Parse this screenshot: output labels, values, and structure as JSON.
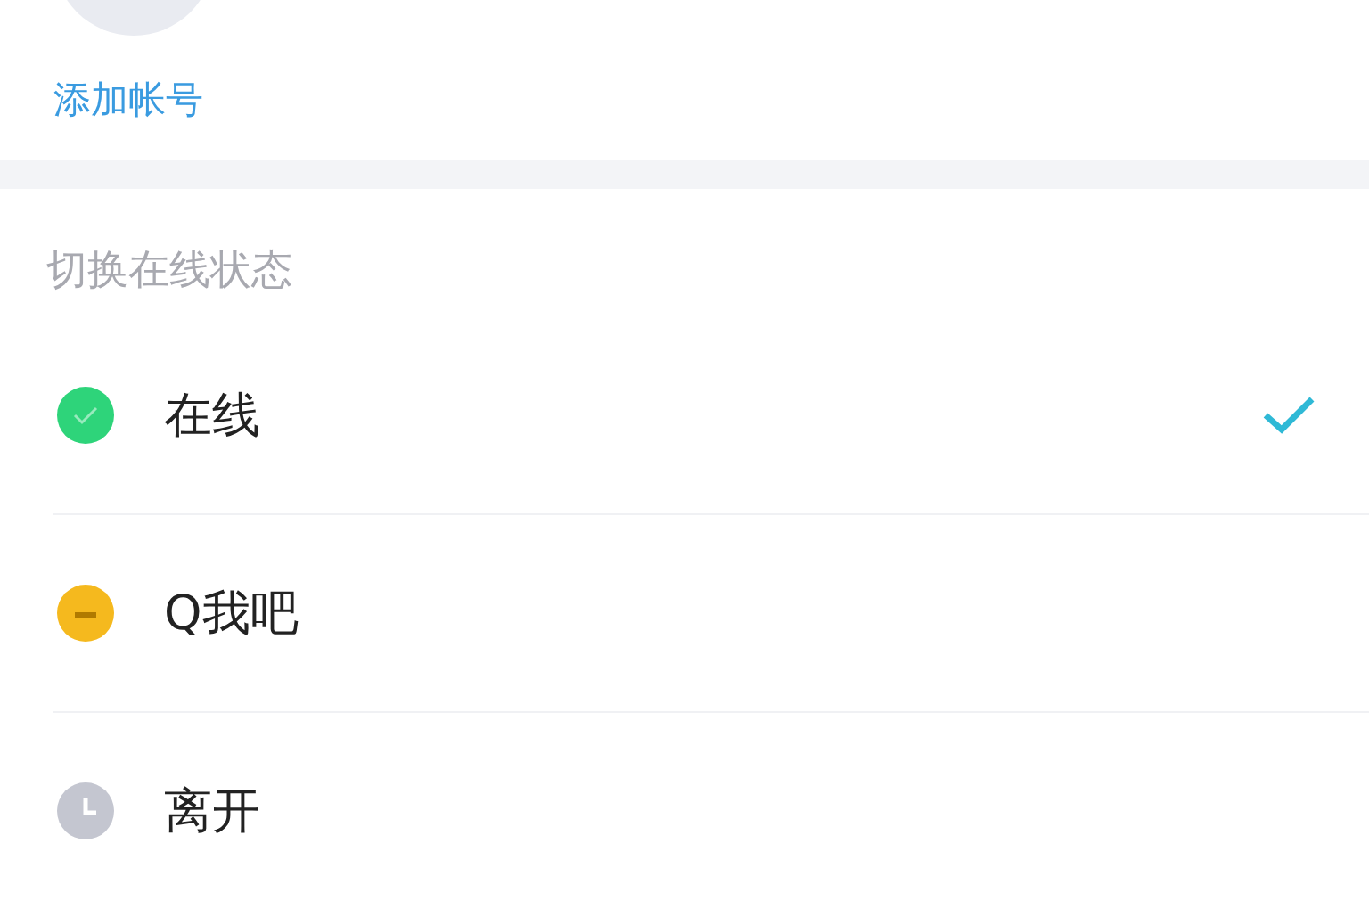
{
  "account": {
    "add_label": "添加帐号"
  },
  "status_section": {
    "title": "切换在线状态",
    "items": [
      {
        "kind": "online",
        "label": "在线",
        "color": "#2ed47a",
        "selected": true
      },
      {
        "kind": "qme",
        "label": "Q我吧",
        "color": "#f5b91e",
        "selected": false
      },
      {
        "kind": "away",
        "label": "离开",
        "color": "#c4c6d0",
        "selected": false
      }
    ]
  }
}
